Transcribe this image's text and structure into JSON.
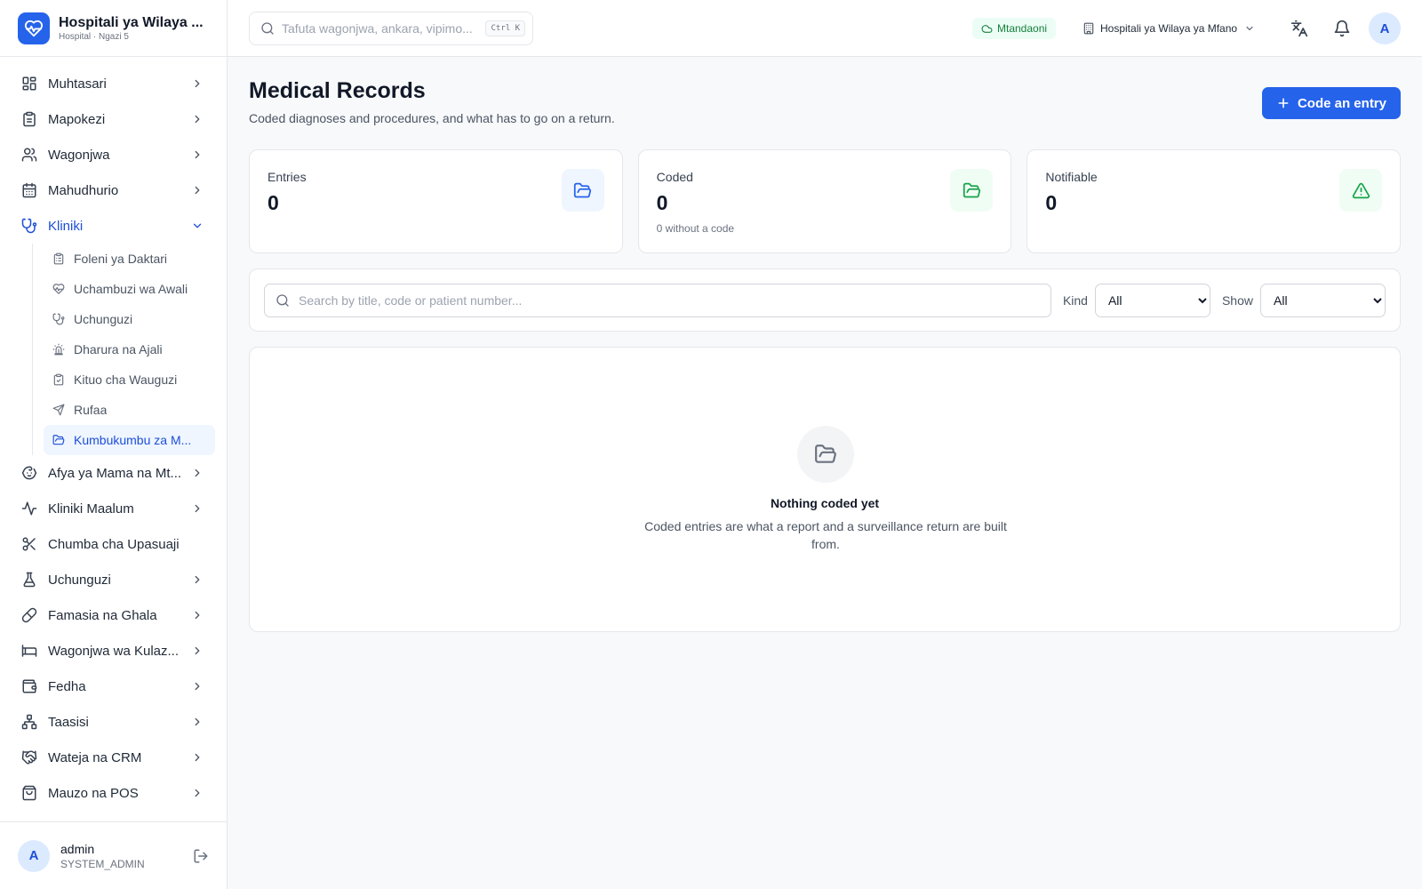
{
  "brand": {
    "name": "Hospitali ya Wilaya ...",
    "subtitle": "Hospital · Ngazi 5"
  },
  "topbar": {
    "search_placeholder": "Tafuta wagonjwa, ankara, vipimo...",
    "shortcut": "Ctrl K",
    "status": "Mtandaoni",
    "facility": "Hospitali ya Wilaya ya Mfano",
    "avatar_initial": "A"
  },
  "sidebar": {
    "items": [
      {
        "label": "Muhtasari",
        "icon": "dashboard-icon"
      },
      {
        "label": "Mapokezi",
        "icon": "clipboard-icon"
      },
      {
        "label": "Wagonjwa",
        "icon": "users-icon"
      },
      {
        "label": "Mahudhurio",
        "icon": "calendar-icon"
      },
      {
        "label": "Kliniki",
        "icon": "stethoscope-icon"
      },
      {
        "label": "Afya ya Mama na Mt...",
        "icon": "baby-icon"
      },
      {
        "label": "Kliniki Maalum",
        "icon": "activity-icon"
      },
      {
        "label": "Chumba cha Upasuaji",
        "icon": "scissors-icon"
      },
      {
        "label": "Uchunguzi",
        "icon": "flask-icon"
      },
      {
        "label": "Famasia na Ghala",
        "icon": "pill-icon"
      },
      {
        "label": "Wagonjwa wa Kulaz...",
        "icon": "bed-icon"
      },
      {
        "label": "Fedha",
        "icon": "wallet-icon"
      },
      {
        "label": "Taasisi",
        "icon": "network-icon"
      },
      {
        "label": "Wateja na CRM",
        "icon": "handshake-icon"
      },
      {
        "label": "Mauzo na POS",
        "icon": "shopping-bag-icon"
      }
    ],
    "subitems": [
      {
        "label": "Foleni ya Daktari",
        "icon": "clipboard-list-icon"
      },
      {
        "label": "Uchambuzi wa Awali",
        "icon": "heart-pulse-icon"
      },
      {
        "label": "Uchunguzi",
        "icon": "stethoscope-icon"
      },
      {
        "label": "Dharura na Ajali",
        "icon": "siren-icon"
      },
      {
        "label": "Kituo cha Wauguzi",
        "icon": "clipboard-check-icon"
      },
      {
        "label": "Rufaa",
        "icon": "send-icon"
      },
      {
        "label": "Kumbukumbu za M...",
        "icon": "folder-open-icon"
      }
    ],
    "user": {
      "name": "admin",
      "role": "SYSTEM_ADMIN",
      "initial": "A"
    }
  },
  "page": {
    "title": "Medical Records",
    "subtitle": "Coded diagnoses and procedures, and what has to go on a return.",
    "action": "Code an entry"
  },
  "stats": [
    {
      "label": "Entries",
      "value": "0",
      "note": "",
      "color": "#2563eb"
    },
    {
      "label": "Coded",
      "value": "0",
      "note": "0 without a code",
      "color": "#16a34a"
    },
    {
      "label": "Notifiable",
      "value": "0",
      "note": "",
      "color": "#16a34a"
    }
  ],
  "filters": {
    "search_placeholder": "Search by title, code or patient number...",
    "kind_label": "Kind",
    "kind_value": "All",
    "show_label": "Show",
    "show_value": "All"
  },
  "empty": {
    "title": "Nothing coded yet",
    "text": "Coded entries are what a report and a surveillance return are built from."
  }
}
